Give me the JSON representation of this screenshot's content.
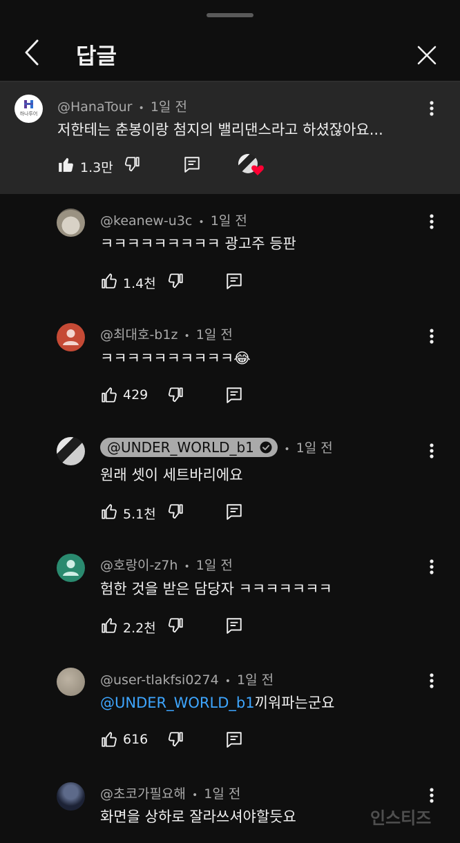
{
  "header": {
    "title": "답글"
  },
  "parent": {
    "author": "@HanaTour",
    "avatar_text": "하나투어",
    "time": "1일 전",
    "text": "저한테는 춘봉이랑 첨지의 밸리댄스라고 하셨잖아요...",
    "likes": "1.3만",
    "liked": true
  },
  "replies": [
    {
      "author": "@keanew-u3c",
      "time": "1일 전",
      "text": "ㅋㅋㅋㅋㅋㅋㅋㅋㅋ 광고주 등판",
      "likes": "1.4천"
    },
    {
      "author": "@최대호-b1z",
      "time": "1일 전",
      "text": "ㅋㅋㅋㅋㅋㅋㅋㅋㅋㅋ",
      "emoji": "😂",
      "likes": "429"
    },
    {
      "author": "@UNDER_WORLD_b1",
      "time": "1일 전",
      "text": "원래 셋이 세트바리에요",
      "likes": "5.1천"
    },
    {
      "author": "@호랑이-z7h",
      "time": "1일 전",
      "text": "험한 것을 받은 담당자 ㅋㅋㅋㅋㅋㅋㅋ",
      "likes": "2.2천"
    },
    {
      "author": "@user-tlakfsi0274",
      "time": "1일 전",
      "mention": "@UNDER_WORLD_b1",
      "text": "끼워파는군요",
      "likes": "616"
    },
    {
      "author": "@초코가필요해",
      "time": "1일 전",
      "text": "화면을 상하로 잘라쓰셔야할듯요"
    }
  ],
  "meta_separator": "•",
  "watermark": "인스티즈",
  "colors": {
    "background": "#0f0f0f",
    "highlight": "#272727",
    "mention": "#3ea6ff",
    "heart": "#ff0033",
    "avatar_red": "#c54a35",
    "avatar_teal": "#2a8a6f"
  },
  "icons": [
    "back-arrow-icon",
    "close-icon",
    "thumbs-up-icon",
    "thumbs-down-icon",
    "reply-icon",
    "more-vert-icon",
    "heart-icon",
    "verified-check-icon"
  ]
}
